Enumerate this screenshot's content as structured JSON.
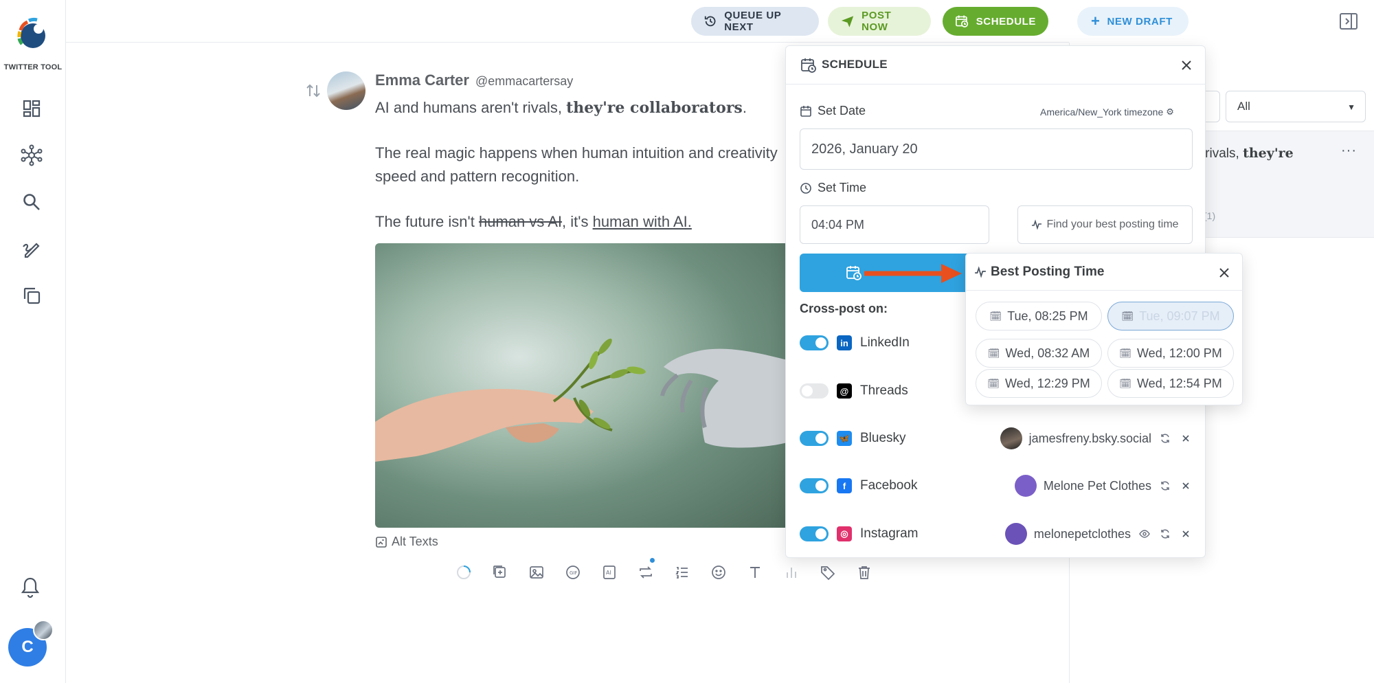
{
  "app": {
    "logo_text": "TWITTER TOOL",
    "user_initial": "C"
  },
  "topbar": {
    "queue_label": "QUEUE UP NEXT",
    "post_now_label": "POST NOW",
    "schedule_label": "SCHEDULE",
    "new_draft_label": "NEW DRAFT"
  },
  "right_panel": {
    "filter_value": "All",
    "item_text_plain": "'t rivals, ",
    "item_text_bold": "they're",
    "item_meta": "(1)"
  },
  "post": {
    "author_name": "Emma Carter",
    "author_handle": "@emmacartersay",
    "line1_plain": "AI and humans aren't rivals, ",
    "line1_bold": "they're collaborators",
    "line1_end": ".",
    "line2": "The real magic happens when human intuition and creativity",
    "line3": "speed and pattern recognition.",
    "line4_start": "The future isn't ",
    "line4_strike": "human vs AI",
    "line4_mid": ", it's ",
    "line4_under": "human with AI. ",
    "alt_texts_label": "Alt Texts"
  },
  "schedule": {
    "title": "SCHEDULE",
    "set_date_label": "Set Date",
    "timezone_label": "America/New_York timezone",
    "date_value": "2026, January 20",
    "set_time_label": "Set Time",
    "time_value": "04:04 PM",
    "best_time_button": "Find your best posting time",
    "crosspost_label": "Cross-post on:",
    "networks": [
      {
        "name": "LinkedIn",
        "on": true,
        "icon": "linkedin-icon",
        "color": "#0a66c2"
      },
      {
        "name": "Threads",
        "on": false,
        "icon": "threads-icon",
        "color": "#000000"
      },
      {
        "name": "Bluesky",
        "on": true,
        "icon": "bluesky-icon",
        "color": "#1d8cf0",
        "account": "jamesfreny.bsky.social"
      },
      {
        "name": "Facebook",
        "on": true,
        "icon": "facebook-icon",
        "color": "#1877f2",
        "account": "Melone Pet Clothes"
      },
      {
        "name": "Instagram",
        "on": true,
        "icon": "instagram-icon",
        "color": "#e1306c",
        "account": "melonepetclothes"
      }
    ]
  },
  "best_time": {
    "title": "Best Posting Time",
    "slots": [
      {
        "label": "Tue, 08:25 PM",
        "selected": false
      },
      {
        "label": "Tue, 09:07 PM",
        "selected": true
      },
      {
        "label": "Wed, 08:32 AM",
        "selected": false
      },
      {
        "label": "Wed, 12:00 PM",
        "selected": false
      },
      {
        "label": "Wed, 12:29 PM",
        "selected": false
      },
      {
        "label": "Wed, 12:54 PM",
        "selected": false
      }
    ]
  },
  "colors": {
    "accent_blue": "#2fa3e0",
    "schedule_green": "#66ad2f",
    "annotation_arrow": "#e8501f"
  }
}
